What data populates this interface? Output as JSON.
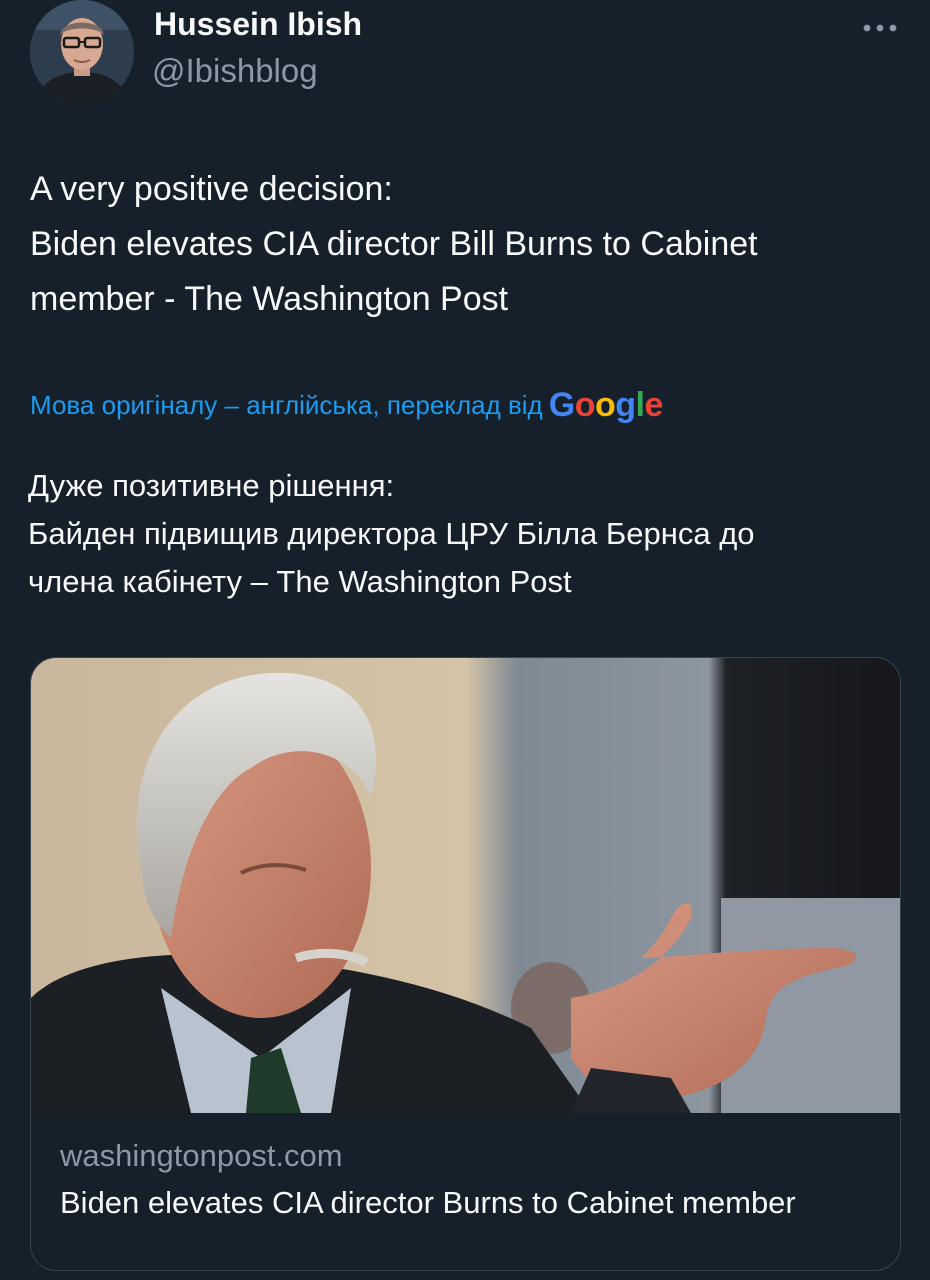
{
  "author": {
    "display_name": "Hussein Ibish",
    "handle": "@Ibishblog"
  },
  "more_icon": "more-horizontal-icon",
  "tweet": {
    "lines": [
      "A very positive decision:",
      "Biden elevates CIA director Bill Burns to Cabinet",
      "member - The Washington Post"
    ]
  },
  "translation": {
    "notice": "Мова оригіналу – англійська, переклад від",
    "provider": "Google",
    "lines": [
      "Дуже позитивне рішення:",
      "Байден підвищив директора ЦРУ Білла Бернса до",
      "члена кабінету – The Washington Post"
    ]
  },
  "link_card": {
    "domain": "washingtonpost.com",
    "title": "Biden elevates CIA director Burns to Cabinet member"
  },
  "colors": {
    "background": "#15202b",
    "text": "#f7f9f9",
    "secondary": "#8b98a5",
    "link": "#1d9bf0",
    "border": "#38444d"
  }
}
